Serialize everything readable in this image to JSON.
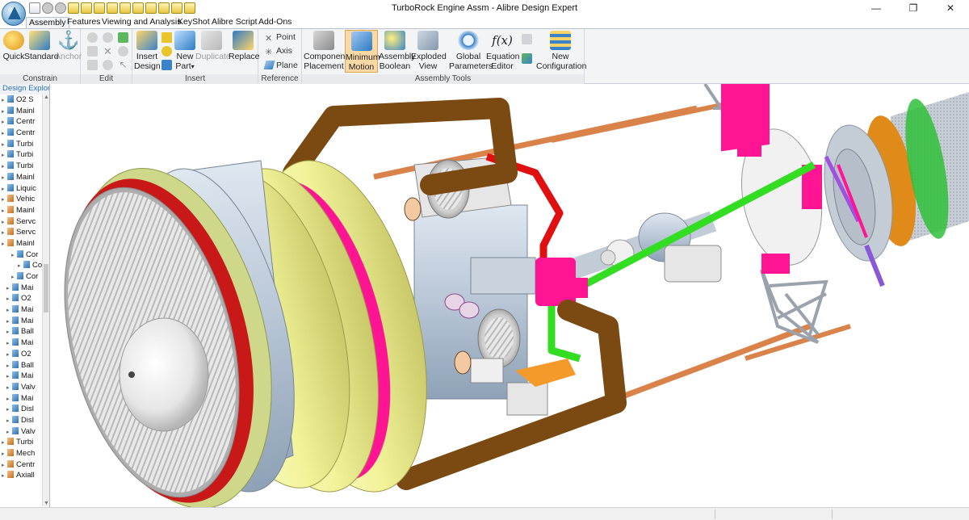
{
  "window": {
    "title": "TurboRock Engine Assm - Alibre Design Expert",
    "controls": [
      "—",
      "❐",
      "✕"
    ]
  },
  "tabs": [
    "Assembly",
    "Features",
    "Viewing and Analysis",
    "KeyShot",
    "Alibre Script",
    "Add-Ons"
  ],
  "ribbon": {
    "constrain": {
      "label": "Constrain",
      "quick": "Quick",
      "standard": "Standard",
      "anchor": "Anchor"
    },
    "edit": {
      "label": "Edit"
    },
    "insert": {
      "label": "Insert",
      "insert_design_1": "Insert",
      "insert_design_2": "Design",
      "new_part_1": "New",
      "new_part_2": "Part",
      "duplicate": "Duplicate",
      "replace": "Replace"
    },
    "reference": {
      "label": "Reference",
      "point": "Point",
      "axis": "Axis",
      "plane": "Plane"
    },
    "assembly_tools": {
      "label": "Assembly Tools",
      "component_placement_1": "Component",
      "component_placement_2": "Placement",
      "minimum_motion_1": "Minimum",
      "minimum_motion_2": "Motion",
      "assembly_boolean_1": "Assembly",
      "assembly_boolean_2": "Boolean",
      "exploded_view_1": "Exploded",
      "exploded_view_2": "View",
      "global_parameters_1": "Global",
      "global_parameters_2": "Parameters",
      "equation_editor_1": "Equation",
      "equation_editor_2": "Editor",
      "new_configuration_1": "New",
      "new_configuration_2": "Configuration"
    }
  },
  "explorer": {
    "header": "Design Explorer",
    "nodes": [
      {
        "label": "O2 S",
        "icon": "blue"
      },
      {
        "label": "Mainl",
        "icon": "blue"
      },
      {
        "label": "Centr",
        "icon": "blue"
      },
      {
        "label": "Centr",
        "icon": "blue"
      },
      {
        "label": "Turbi",
        "icon": "blue"
      },
      {
        "label": "Turbi",
        "icon": "blue"
      },
      {
        "label": "Turbi",
        "icon": "blue"
      },
      {
        "label": "Mainl",
        "icon": "blue"
      },
      {
        "label": "Liquic",
        "icon": "blue"
      },
      {
        "label": "Vehic",
        "icon": "orange"
      },
      {
        "label": "Mainl",
        "icon": "orange"
      },
      {
        "label": "Servc",
        "icon": "orange"
      },
      {
        "label": "Servc",
        "icon": "orange"
      },
      {
        "label": "Mainl",
        "icon": "orange"
      },
      {
        "label": "Cor",
        "icon": "blue"
      },
      {
        "label": "Co",
        "icon": "blue"
      },
      {
        "label": "Cor",
        "icon": "blue"
      },
      {
        "label": "Mai",
        "icon": "blue"
      },
      {
        "label": "O2",
        "icon": "blue"
      },
      {
        "label": "Mai",
        "icon": "blue"
      },
      {
        "label": "Mai",
        "icon": "blue"
      },
      {
        "label": "Ball",
        "icon": "blue"
      },
      {
        "label": "Mai",
        "icon": "blue"
      },
      {
        "label": "O2",
        "icon": "blue"
      },
      {
        "label": "Ball",
        "icon": "blue"
      },
      {
        "label": "Mai",
        "icon": "blue"
      },
      {
        "label": "Valv",
        "icon": "blue"
      },
      {
        "label": "Mai",
        "icon": "blue"
      },
      {
        "label": "Disl",
        "icon": "blue"
      },
      {
        "label": "Disl",
        "icon": "blue"
      },
      {
        "label": "Valv",
        "icon": "blue"
      },
      {
        "label": "Turbi",
        "icon": "orange"
      },
      {
        "label": "Mech",
        "icon": "orange"
      },
      {
        "label": "Centr",
        "icon": "orange"
      },
      {
        "label": "Axiall",
        "icon": "orange"
      }
    ]
  },
  "colors": {
    "brown_pipe": "#7a4a12",
    "orange_pipe": "#d9824a",
    "green_pipe": "#33dd22",
    "red_pipe": "#e01010",
    "magenta": "#ff1493",
    "yellow_ring": "#f3f39a",
    "grey_body": "#b8c6d6",
    "fan_blades": "#dcdcdc",
    "ribbon_selected": "#fbd9a6"
  }
}
